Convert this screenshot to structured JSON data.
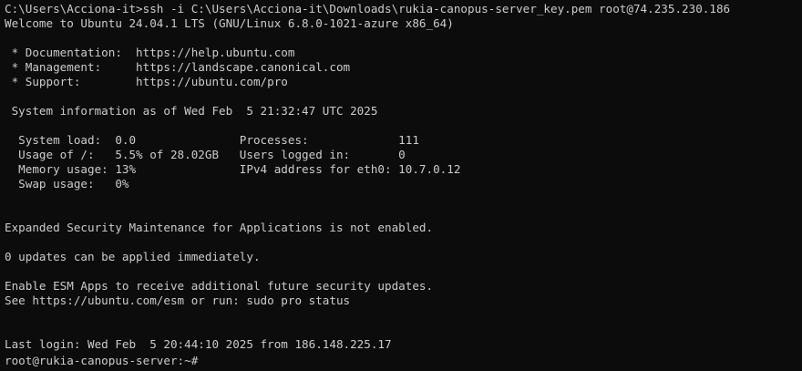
{
  "colors": {
    "background": "#0c0c0c",
    "foreground": "#cccccc"
  },
  "terminal": {
    "lines": [
      "C:\\Users\\Acciona-it>ssh -i C:\\Users\\Acciona-it\\Downloads\\rukia-canopus-server_key.pem root@74.235.230.186",
      "Welcome to Ubuntu 24.04.1 LTS (GNU/Linux 6.8.0-1021-azure x86_64)",
      "",
      " * Documentation:  https://help.ubuntu.com",
      " * Management:     https://landscape.canonical.com",
      " * Support:        https://ubuntu.com/pro",
      "",
      " System information as of Wed Feb  5 21:32:47 UTC 2025",
      "",
      "  System load:  0.0               Processes:             111",
      "  Usage of /:   5.5% of 28.02GB   Users logged in:       0",
      "  Memory usage: 13%               IPv4 address for eth0: 10.7.0.12",
      "  Swap usage:   0%",
      "",
      "",
      "Expanded Security Maintenance for Applications is not enabled.",
      "",
      "0 updates can be applied immediately.",
      "",
      "Enable ESM Apps to receive additional future security updates.",
      "See https://ubuntu.com/esm or run: sudo pro status",
      "",
      "",
      "Last login: Wed Feb  5 20:44:10 2025 from 186.148.225.17"
    ],
    "prompt": "root@rukia-canopus-server:~#"
  }
}
